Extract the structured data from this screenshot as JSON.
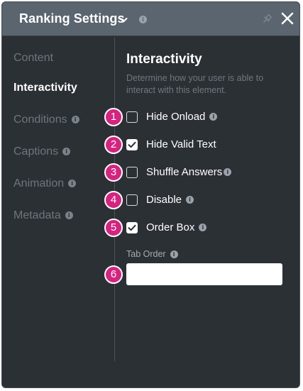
{
  "header": {
    "title": "Ranking Settings",
    "info": "i"
  },
  "sidebar": {
    "items": [
      {
        "label": "Content",
        "active": false,
        "info": ""
      },
      {
        "label": "Interactivity",
        "active": true,
        "info": ""
      },
      {
        "label": "Conditions",
        "active": false,
        "info": "i"
      },
      {
        "label": "Captions",
        "active": false,
        "info": "i"
      },
      {
        "label": "Animation",
        "active": false,
        "info": "i"
      },
      {
        "label": "Metadata",
        "active": false,
        "info": "i"
      }
    ]
  },
  "section": {
    "title": "Interactivity",
    "description": "Determine how your user is able to interact with this element."
  },
  "options": [
    {
      "badge": "1",
      "label": "Hide Onload",
      "checked": false,
      "info": "i"
    },
    {
      "badge": "2",
      "label": "Hide Valid Text",
      "checked": true,
      "info": ""
    },
    {
      "badge": "3",
      "label": "Shuffle Answers",
      "checked": false,
      "info": "i"
    },
    {
      "badge": "4",
      "label": "Disable",
      "checked": false,
      "info": "i"
    },
    {
      "badge": "5",
      "label": "Order Box",
      "checked": true,
      "info": "i"
    }
  ],
  "tab_order": {
    "badge": "6",
    "label": "Tab Order",
    "info": "i",
    "value": ""
  },
  "colors": {
    "accent_badge": "#d6237f",
    "header_bg": "#5a656f",
    "panel_bg": "#2b3035"
  }
}
